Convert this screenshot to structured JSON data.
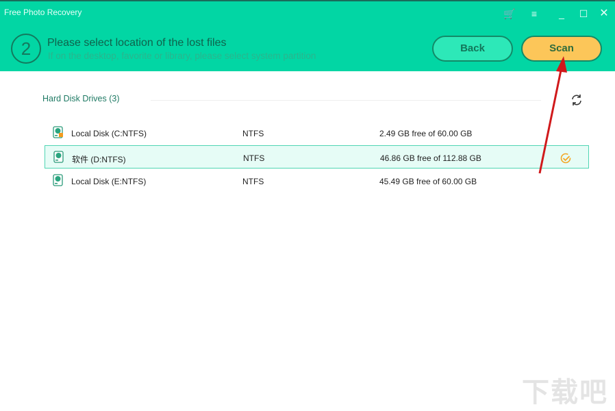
{
  "app": {
    "title": "Free Photo Recovery"
  },
  "header": {
    "step": "2",
    "title": "Please select location of the lost files",
    "subtitle": "If on the desktop, favorite or library, please select system partition",
    "back_label": "Back",
    "scan_label": "Scan"
  },
  "section": {
    "title": "Hard Disk Drives (3)"
  },
  "drives": [
    {
      "name": "Local Disk (C:NTFS)",
      "fs": "NTFS",
      "space": "2.49 GB free of 60.00 GB",
      "selected": false,
      "icon": "system-disk-icon"
    },
    {
      "name": "软件 (D:NTFS)",
      "fs": "NTFS",
      "space": "46.86 GB free of 112.88 GB",
      "selected": true,
      "icon": "disk-icon"
    },
    {
      "name": "Local Disk (E:NTFS)",
      "fs": "NTFS",
      "space": "45.49 GB free of 60.00 GB",
      "selected": false,
      "icon": "disk-icon"
    }
  ],
  "watermark": "下载吧",
  "colors": {
    "header": "#02d6a4",
    "scan": "#fcc659",
    "back": "#2de8b8",
    "selected_row": "#e6fcf6",
    "check": "#f5a623",
    "annotation_arrow": "#d0191b"
  }
}
